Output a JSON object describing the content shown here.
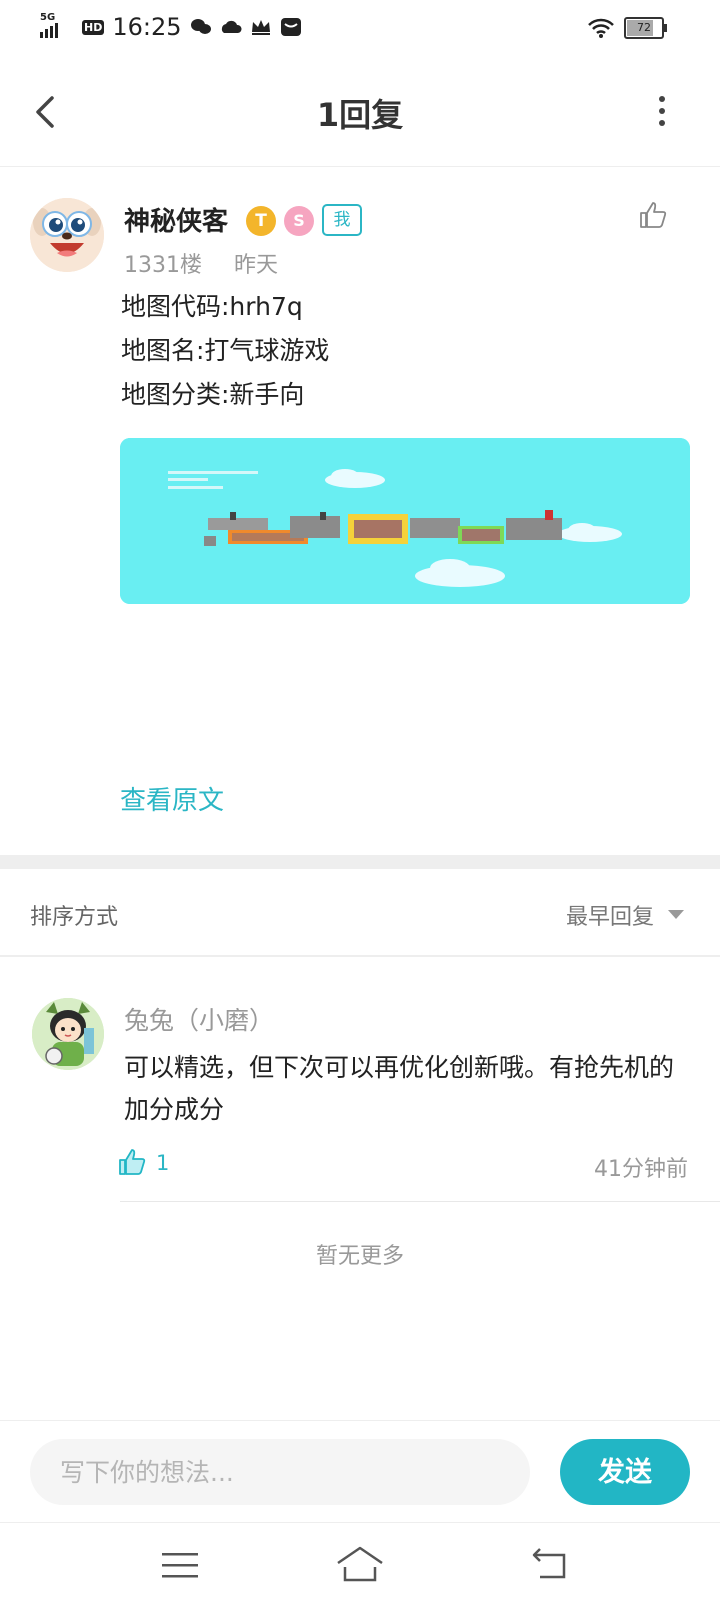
{
  "status_bar": {
    "network": "5G",
    "hd": "HD",
    "time": "16:25",
    "battery": "72",
    "battery_level": 0.72
  },
  "header": {
    "title": "1回复"
  },
  "post": {
    "username": "神秘侠客",
    "badge_t": "T",
    "badge_s": "S",
    "me_badge": "我",
    "floor": "1331楼",
    "time": "昨天",
    "lines": [
      "地图代码:hrh7q",
      "地图名:打气球游戏",
      "地图分类:新手向"
    ],
    "view_original": "查看原文"
  },
  "sort": {
    "label": "排序方式",
    "value": "最早回复"
  },
  "comment": {
    "username": "兔兔（小磨）",
    "text": "可以精选，但下次可以再优化创新哦。有抢先机的加分成分",
    "likes": "1",
    "time": "41分钟前"
  },
  "no_more": "暂无更多",
  "input": {
    "placeholder": "写下你的想法..."
  },
  "send_label": "发送",
  "colors": {
    "accent": "#22b6c5",
    "map_bg": "#69eef2"
  },
  "icons": [
    "back-arrow-icon",
    "more-vertical-icon",
    "thumbs-up-icon",
    "menu-icon",
    "home-icon",
    "nav-back-icon",
    "wifi-icon"
  ]
}
